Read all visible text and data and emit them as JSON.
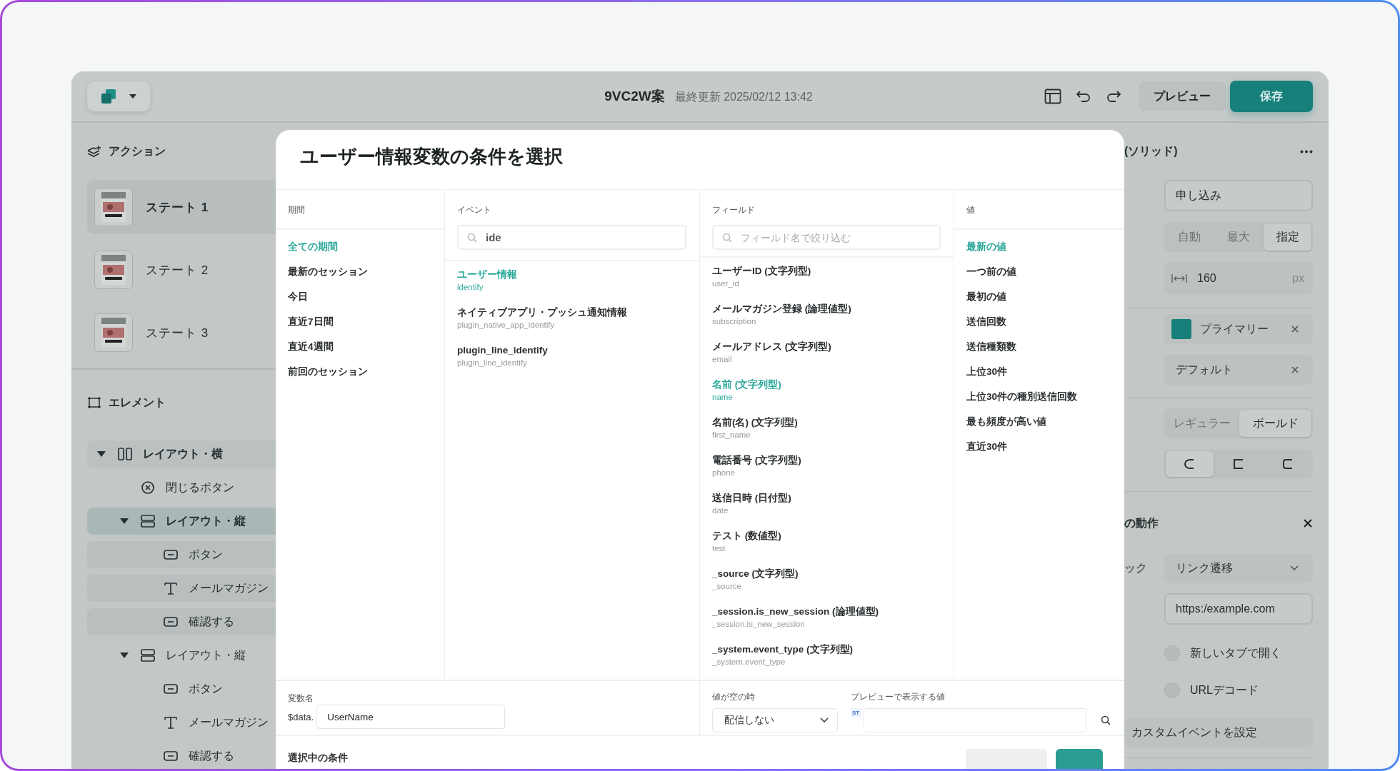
{
  "app_bar": {
    "title": "9VC2W案",
    "updated": "最終更新 2025/02/12 13:42",
    "preview_button": "プレビュー",
    "save_button": "保存"
  },
  "actions": {
    "heading": "アクション",
    "states": [
      {
        "label": "ステート 1",
        "selected": true
      },
      {
        "label": "ステート 2",
        "selected": false
      },
      {
        "label": "ステート 3",
        "selected": false
      }
    ]
  },
  "elements": {
    "heading": "エレメント",
    "tree": [
      {
        "kind": "row",
        "label": "レイアウト・横",
        "expanded": true,
        "selected": false,
        "hovered": true,
        "children": [
          {
            "kind": "close",
            "label": "閉じるボタン",
            "selected": false
          },
          {
            "kind": "column",
            "label": "レイアウト・縦",
            "expanded": true,
            "selected": true,
            "children": [
              {
                "kind": "button",
                "label": "ボタン",
                "selected": false
              },
              {
                "kind": "text",
                "label": "メールマガジン",
                "selected": false
              },
              {
                "kind": "button",
                "label": "確認する",
                "selected": false
              }
            ]
          },
          {
            "kind": "column",
            "label": "レイアウト・縦",
            "expanded": true,
            "selected": false,
            "children": [
              {
                "kind": "button",
                "label": "ボタン",
                "selected": false
              },
              {
                "kind": "text",
                "label": "メールマガジン",
                "selected": false
              },
              {
                "kind": "button",
                "label": "確認する",
                "selected": false
              }
            ]
          }
        ]
      }
    ]
  },
  "dialog": {
    "title": "ユーザー情報変数の条件を選択",
    "periods": {
      "heading": "期間",
      "items": [
        {
          "label": "全ての期間",
          "selected": true
        },
        {
          "label": "最新のセッション",
          "selected": false
        },
        {
          "label": "今日",
          "selected": false
        },
        {
          "label": "直近7日間",
          "selected": false
        },
        {
          "label": "直近4週間",
          "selected": false
        },
        {
          "label": "前回のセッション",
          "selected": false
        }
      ]
    },
    "events": {
      "heading": "イベント",
      "search_value": "ide",
      "items": [
        {
          "label": "ユーザー情報",
          "key": "identify",
          "selected": true
        },
        {
          "label": "ネイティブアプリ・プッシュ通知情報",
          "key": "plugin_native_app_identify",
          "selected": false
        },
        {
          "label": "plugin_line_identify",
          "key": "plugin_line_identify",
          "selected": false
        }
      ]
    },
    "fields": {
      "heading": "フィールド",
      "search_placeholder": "フィールド名で絞り込む",
      "items": [
        {
          "label": "ユーザーID (文字列型)",
          "key": "user_id",
          "selected": false
        },
        {
          "label": "メールマガジン登録 (論理値型)",
          "key": "subscription",
          "selected": false
        },
        {
          "label": "メールアドレス (文字列型)",
          "key": "email",
          "selected": false
        },
        {
          "label": "名前 (文字列型)",
          "key": "name",
          "selected": true
        },
        {
          "label": "名前(名) (文字列型)",
          "key": "first_name",
          "selected": false
        },
        {
          "label": "電話番号 (文字列型)",
          "key": "phone",
          "selected": false
        },
        {
          "label": "送信日時 (日付型)",
          "key": "date",
          "selected": false
        },
        {
          "label": "テスト (数値型)",
          "key": "test",
          "selected": false
        },
        {
          "label": "_source (文字列型)",
          "key": "_source",
          "selected": false
        },
        {
          "label": "_session.is_new_session (論理値型)",
          "key": "_session.is_new_session",
          "selected": false
        },
        {
          "label": "_system.event_type (文字列型)",
          "key": "_system.event_type",
          "selected": false
        }
      ]
    },
    "values": {
      "heading": "値",
      "items": [
        {
          "label": "最新の値",
          "selected": true
        },
        {
          "label": "一つ前の値",
          "selected": false
        },
        {
          "label": "最初の値",
          "selected": false
        },
        {
          "label": "送信回数",
          "selected": false
        },
        {
          "label": "送信種類数",
          "selected": false
        },
        {
          "label": "上位30件",
          "selected": false
        },
        {
          "label": "上位30件の種別送信回数",
          "selected": false
        },
        {
          "label": "最も頻度が高い値",
          "selected": false
        },
        {
          "label": "直近30件",
          "selected": false
        }
      ]
    },
    "variable_name": {
      "label": "変数名",
      "prefix": "$data.",
      "value": "UserName"
    },
    "empty_value": {
      "label": "値が空の時",
      "value": "配信しない"
    },
    "preview_value": {
      "label": "プレビューで表示する値",
      "badge": "ST"
    },
    "selected_conditions": {
      "label": "選択中の条件"
    },
    "buttons": [
      {
        "kind": "secondary"
      },
      {
        "kind": "primary"
      }
    ]
  },
  "properties": {
    "title": "(ソリッド)",
    "text_value": "申し込み",
    "width_modes": [
      {
        "label": "自動",
        "selected": false
      },
      {
        "label": "最大",
        "selected": false
      },
      {
        "label": "指定",
        "selected": true
      }
    ],
    "width_value": "160",
    "width_unit": "px",
    "color_chip": "プライマリー",
    "font_chip": "デフォルト",
    "weights": [
      {
        "label": "レギュラー",
        "selected": false
      },
      {
        "label": "ボールド",
        "selected": true
      }
    ],
    "corners": [
      {
        "kind": "round",
        "selected": true
      },
      {
        "kind": "square",
        "selected": false
      },
      {
        "kind": "soft",
        "selected": false
      }
    ]
  },
  "click_action": {
    "title": "の動作",
    "trigger_label": "ック",
    "action": "リンク遷移",
    "url": "https:/example.com",
    "options": [
      {
        "label": "新しいタブで開く",
        "on": false
      },
      {
        "label": "URLデコード",
        "on": false
      }
    ],
    "custom_event": "カスタムイベントを設定"
  }
}
